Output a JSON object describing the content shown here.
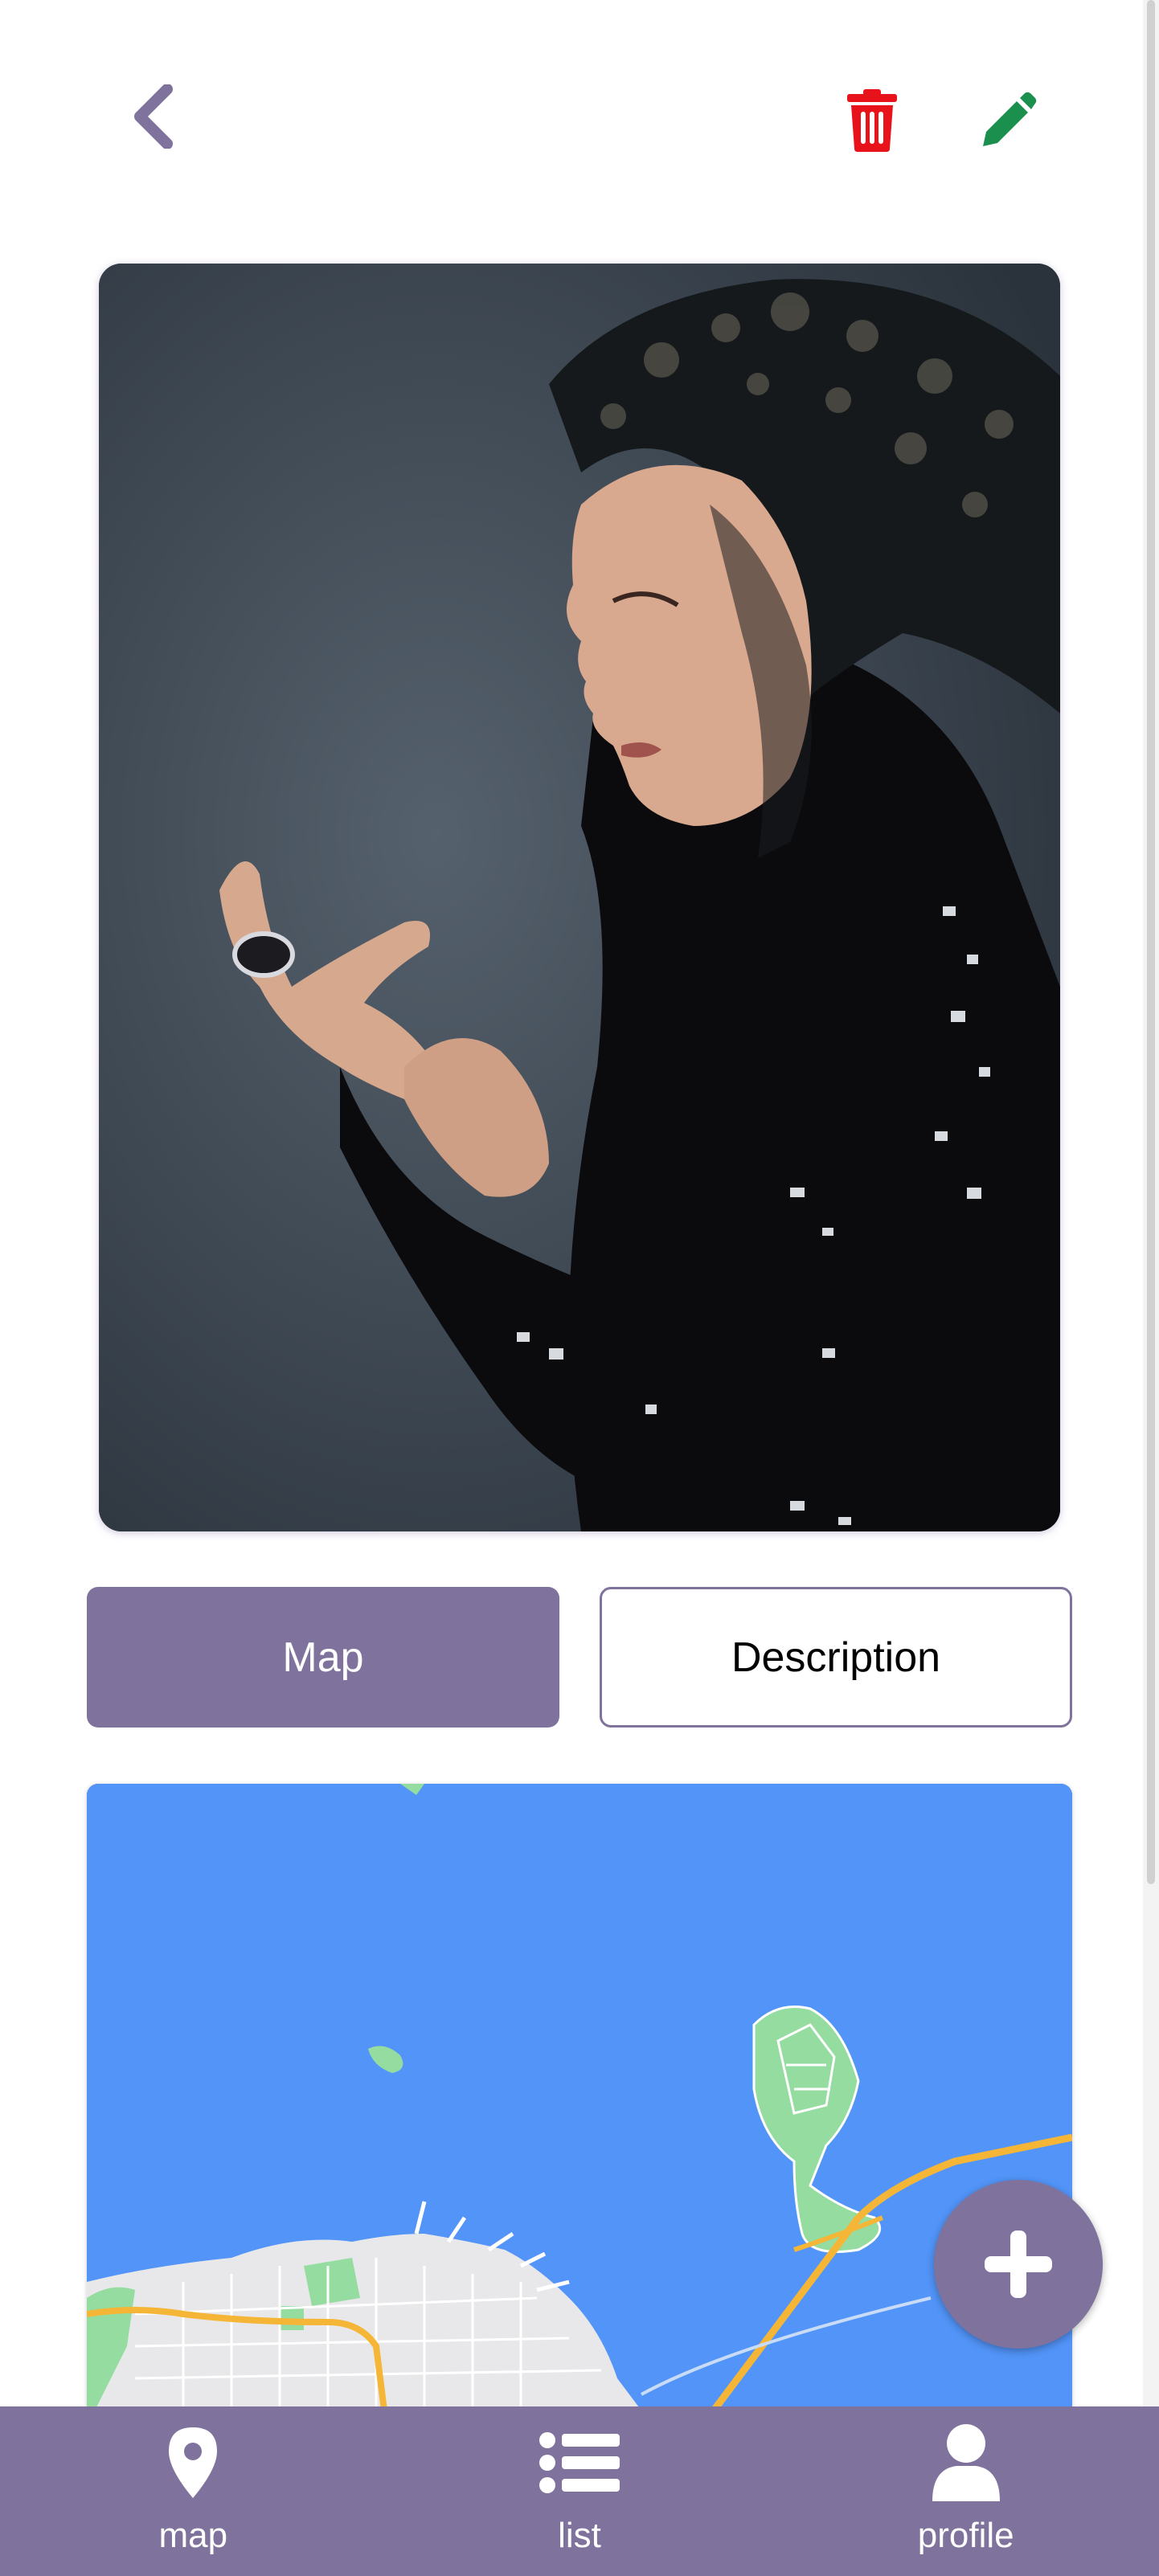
{
  "header": {
    "back_icon": "chevron-left-icon",
    "delete_icon": "trash-icon",
    "edit_icon": "pencil-icon"
  },
  "tabs": [
    {
      "label": "Map",
      "active": true
    },
    {
      "label": "Description",
      "active": false
    }
  ],
  "fab": {
    "icon": "plus-icon"
  },
  "bottom_nav": [
    {
      "label": "map",
      "icon": "map-marker-icon"
    },
    {
      "label": "list",
      "icon": "list-icon"
    },
    {
      "label": "profile",
      "icon": "user-icon"
    }
  ],
  "colors": {
    "accent": "#7f729d",
    "delete": "#e8121b",
    "edit": "#1a8f4e",
    "water": "#5294f8",
    "park": "#94dca0",
    "road": "#f5b637"
  }
}
